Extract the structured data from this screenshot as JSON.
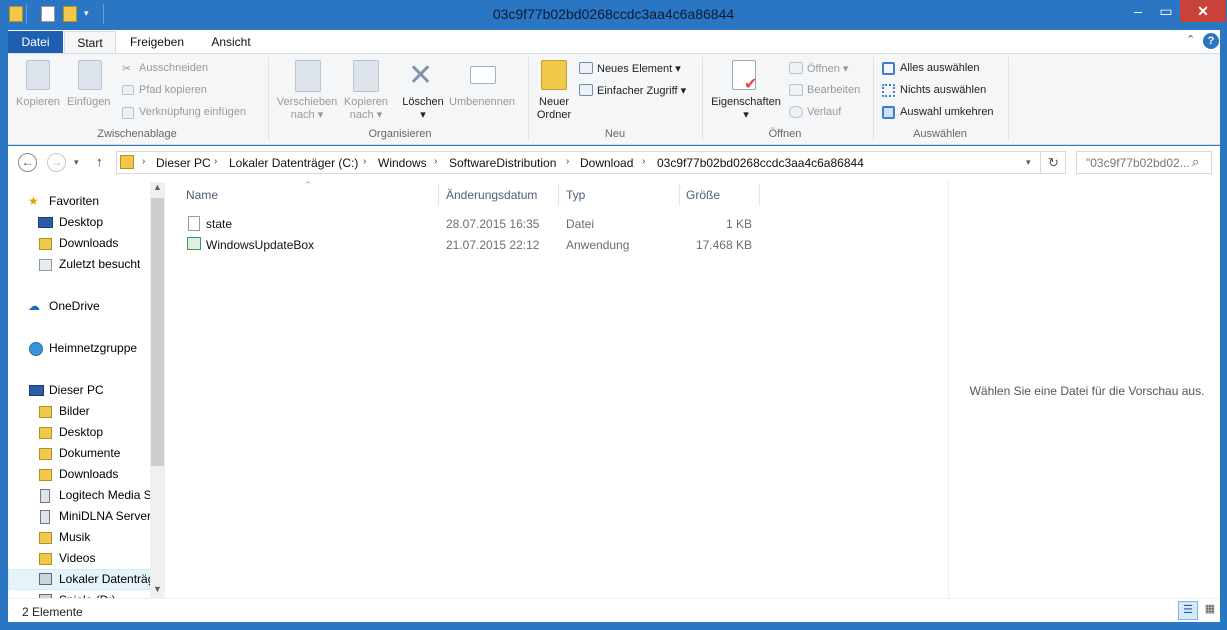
{
  "window": {
    "title": "03c9f77b02bd0268ccdc3aa4c6a86844"
  },
  "tabs": {
    "datei": "Datei",
    "start": "Start",
    "freigeben": "Freigeben",
    "ansicht": "Ansicht"
  },
  "ribbon": {
    "clipboard": {
      "group": "Zwischenablage",
      "kopieren": "Kopieren",
      "einfuegen": "Einfügen",
      "ausschneiden": "Ausschneiden",
      "pfad": "Pfad kopieren",
      "verknuepfung": "Verknüpfung einfügen"
    },
    "organize": {
      "group": "Organisieren",
      "verschieben_1": "Verschieben",
      "verschieben_2": "nach",
      "kopieren_1": "Kopieren",
      "kopieren_2": "nach",
      "loeschen": "Löschen",
      "umbenennen": "Umbenennen"
    },
    "new": {
      "group": "Neu",
      "neuer_1": "Neuer",
      "neuer_2": "Ordner",
      "neues_element": "Neues Element",
      "einfacher_zugriff": "Einfacher Zugriff"
    },
    "open": {
      "group": "Öffnen",
      "eigenschaften": "Eigenschaften",
      "oeffnen": "Öffnen",
      "bearbeiten": "Bearbeiten",
      "verlauf": "Verlauf"
    },
    "select": {
      "group": "Auswählen",
      "alles": "Alles auswählen",
      "nichts": "Nichts auswählen",
      "umkehren": "Auswahl umkehren"
    }
  },
  "address": {
    "crumbs": [
      "Dieser PC",
      "Lokaler Datenträger (C:)",
      "Windows",
      "SoftwareDistribution",
      "Download",
      "03c9f77b02bd0268ccdc3aa4c6a86844"
    ],
    "search_placeholder": "\"03c9f77b02bd02..."
  },
  "nav": {
    "favoriten": "Favoriten",
    "desktop": "Desktop",
    "downloads": "Downloads",
    "zuletzt": "Zuletzt besucht",
    "onedrive": "OneDrive",
    "heimnetz": "Heimnetzgruppe",
    "dieser_pc": "Dieser PC",
    "bilder": "Bilder",
    "desktop2": "Desktop",
    "dokumente": "Dokumente",
    "downloads2": "Downloads",
    "logitech": "Logitech Media S",
    "minidlna": "MiniDLNA Server",
    "musik": "Musik",
    "videos": "Videos",
    "lokal": "Lokaler Datenträg",
    "spiele": "Spiele (D:)"
  },
  "columns": {
    "name": "Name",
    "date": "Änderungsdatum",
    "type": "Typ",
    "size": "Größe"
  },
  "files": [
    {
      "name": "state",
      "date": "28.07.2015 16:35",
      "type": "Datei",
      "size": "1 KB"
    },
    {
      "name": "WindowsUpdateBox",
      "date": "21.07.2015 22:12",
      "type": "Anwendung",
      "size": "17.468 KB"
    }
  ],
  "preview": {
    "message": "Wählen Sie eine Datei für die Vorschau aus."
  },
  "status": {
    "count": "2 Elemente"
  }
}
